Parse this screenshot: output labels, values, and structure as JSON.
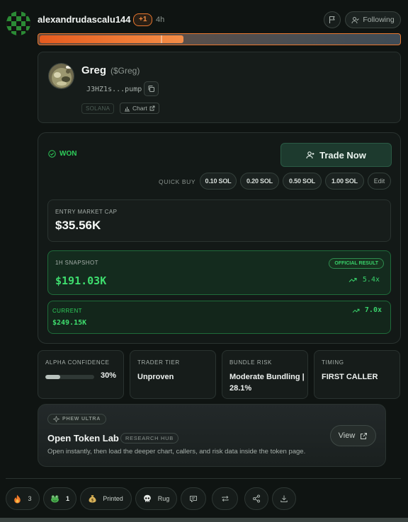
{
  "post": {
    "username": "alexandrudascalu144",
    "badge": "+1",
    "time": "4h",
    "following_label": "Following",
    "progress_fraction": 0.4
  },
  "token": {
    "name": "Greg",
    "ticker": "($Greg)",
    "address": "J3HZ1s...pump",
    "chain": "SOLANA",
    "chart_label": "Chart"
  },
  "result": {
    "status": "WON",
    "trade_label": "Trade Now",
    "quick_buy_label": "QUICK BUY",
    "quick_buy_options": [
      "0.10 SOL",
      "0.20 SOL",
      "0.50 SOL",
      "1.00 SOL"
    ],
    "edit_label": "Edit",
    "entry": {
      "label": "ENTRY MARKET CAP",
      "value": "$35.56K"
    },
    "snapshot": {
      "label": "1H SNAPSHOT",
      "badge": "OFFICIAL RESULT",
      "value": "$191.03K",
      "multiple": "5.4x"
    },
    "current": {
      "label": "CURRENT",
      "value": "$249.15K",
      "multiple": "7.0x"
    }
  },
  "stats": {
    "confidence": {
      "label": "ALPHA CONFIDENCE",
      "value": "30%",
      "fraction": 0.3
    },
    "tier": {
      "label": "TRADER TIER",
      "value": "Unproven"
    },
    "bundle": {
      "label": "BUNDLE RISK",
      "value": "Moderate Bundling | 28.1%"
    },
    "timing": {
      "label": "TIMING",
      "value": "FIRST CALLER"
    }
  },
  "lab": {
    "badge": "PHEW ULTRA",
    "title": "Open Token Lab",
    "tag": "RESEARCH HUB",
    "description": "Open instantly, then load the deeper chart, callers, and risk data inside the token page.",
    "view_label": "View"
  },
  "actions": {
    "fire_count": "3",
    "frog_count": "1",
    "printed_label": "Printed",
    "rug_label": "Rug"
  },
  "colors": {
    "accent_green": "#2ecc5a",
    "accent_orange": "#e8762e",
    "background": "#0f1412"
  }
}
